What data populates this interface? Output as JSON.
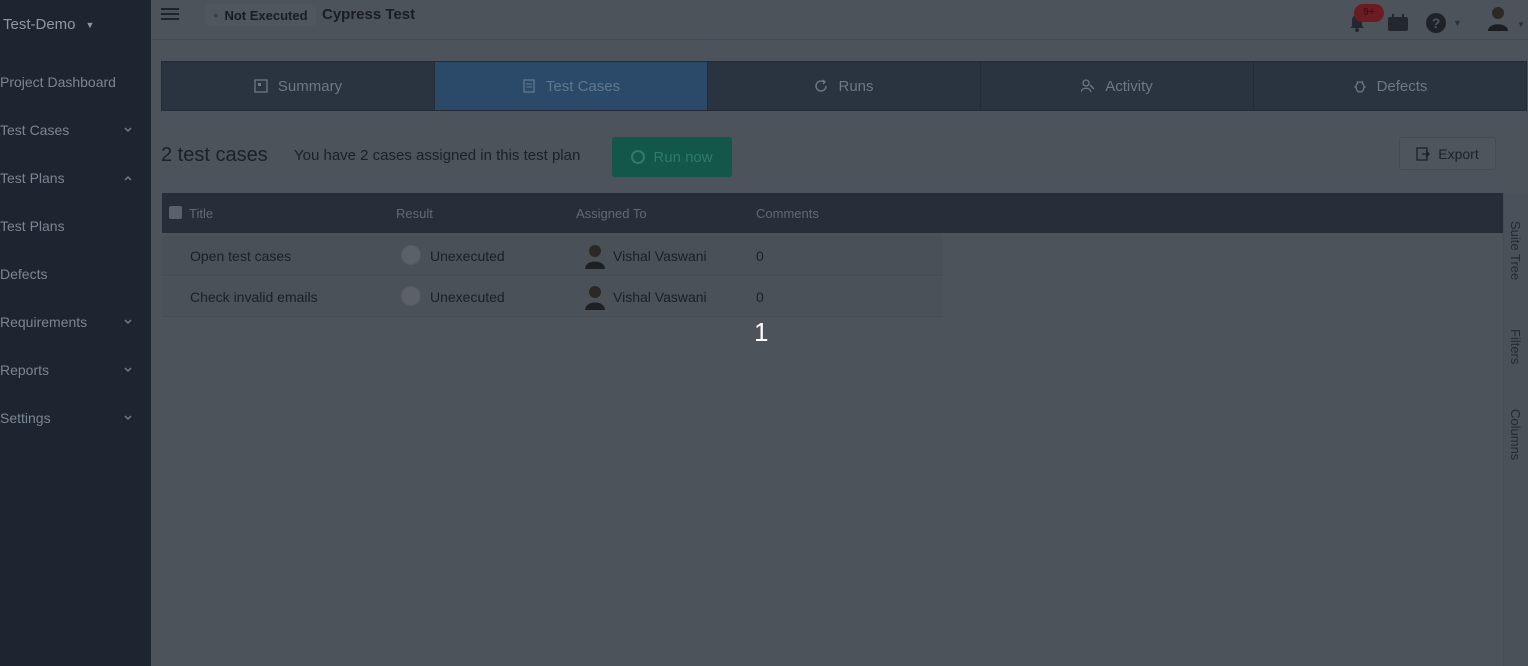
{
  "sidebar": {
    "project": "Test-Demo",
    "items": [
      {
        "label": "Project Dashboard",
        "chevron": ""
      },
      {
        "label": "Test Cases",
        "chevron": "v"
      },
      {
        "label": "Test Plans",
        "chevron": "^"
      },
      {
        "label": "Test Plans",
        "chevron": ""
      },
      {
        "label": "Defects",
        "chevron": ""
      },
      {
        "label": "Requirements",
        "chevron": "v"
      },
      {
        "label": "Reports",
        "chevron": "v"
      },
      {
        "label": "Settings",
        "chevron": "v"
      }
    ]
  },
  "topbar": {
    "status": "Not Executed",
    "run_title": "Cypress Test",
    "notification_badge": "9+",
    "help_label": "?"
  },
  "tabs": [
    {
      "label": "Summary",
      "icon": "summary-icon"
    },
    {
      "label": "Test Cases",
      "icon": "test-cases-icon"
    },
    {
      "label": "Runs",
      "icon": "refresh-icon"
    },
    {
      "label": "Activity",
      "icon": "activity-icon"
    },
    {
      "label": "Defects",
      "icon": "bug-icon"
    }
  ],
  "header": {
    "count_title": "2 test cases",
    "assigned_message": "You have 2 cases assigned in this test plan",
    "run_now_label": "Run now",
    "export_label": "Export"
  },
  "table": {
    "columns": [
      "Title",
      "Result",
      "Assigned To",
      "Comments"
    ],
    "rows": [
      {
        "title": "Open test cases",
        "result": "Unexecuted",
        "assigned_to": "Vishal Vaswani",
        "comments": "0"
      },
      {
        "title": "Check invalid emails",
        "result": "Unexecuted",
        "assigned_to": "Vishal Vaswani",
        "comments": "0"
      }
    ],
    "page": "1"
  },
  "side_panel": {
    "suite_tree": "Suite Tree",
    "filters": "Filters",
    "columns": "Columns"
  },
  "colors": {
    "sidebar_bg": "#1d2630",
    "tab_active": "#2b4a6a",
    "run_button": "#13574a",
    "badge": "#6b1c22"
  }
}
